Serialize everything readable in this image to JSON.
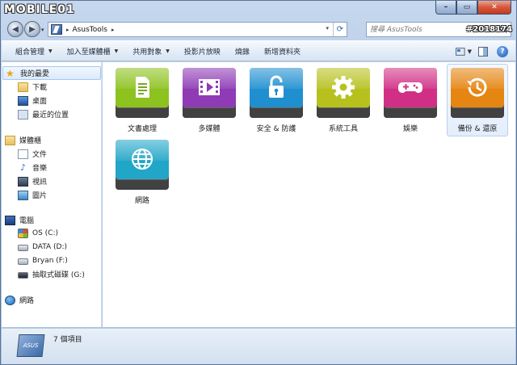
{
  "watermark": "MOBILE01",
  "post_id": "#2018174",
  "window_buttons": {
    "minimize": "–",
    "maximize": "▭",
    "close": "✕"
  },
  "address": {
    "path": "AsusTools",
    "sep": "▸",
    "trail": "▸"
  },
  "search": {
    "placeholder": "搜尋 AsusTools"
  },
  "toolbar": {
    "organize": "組合管理",
    "add_to_library": "加入至媒體櫃",
    "share_with": "共用對象",
    "slideshow": "投影片放映",
    "burn": "燒錄",
    "new_folder": "新增資料夾"
  },
  "sidebar": {
    "favorites": "我的最愛",
    "downloads": "下載",
    "desktop": "桌面",
    "recent": "最近的位置",
    "libraries": "媒體櫃",
    "documents": "文件",
    "music": "音樂",
    "videos": "視訊",
    "pictures": "圖片",
    "computer": "電腦",
    "drive_c": "OS (C:)",
    "drive_d": "DATA (D:)",
    "drive_f": "Bryan (F:)",
    "drive_g": "抽取式磁碟 (G:)",
    "network": "網路"
  },
  "items": [
    {
      "label": "文書處理",
      "color": "#8dc21f",
      "icon": "document-icon"
    },
    {
      "label": "多媒體",
      "color": "#8e3bb5",
      "icon": "play-icon"
    },
    {
      "label": "安全 & 防護",
      "color": "#1f8fd0",
      "icon": "lock-icon"
    },
    {
      "label": "系統工具",
      "color": "#b7c11e",
      "icon": "gear-icon"
    },
    {
      "label": "娛樂",
      "color": "#d12f86",
      "icon": "gamepad-icon"
    },
    {
      "label": "備份 & 還原",
      "color": "#e58512",
      "icon": "clock-icon"
    },
    {
      "label": "網路",
      "color": "#21a6c8",
      "icon": "globe-icon"
    }
  ],
  "status": {
    "count": "7 個項目",
    "logo_text": "ASUS"
  }
}
